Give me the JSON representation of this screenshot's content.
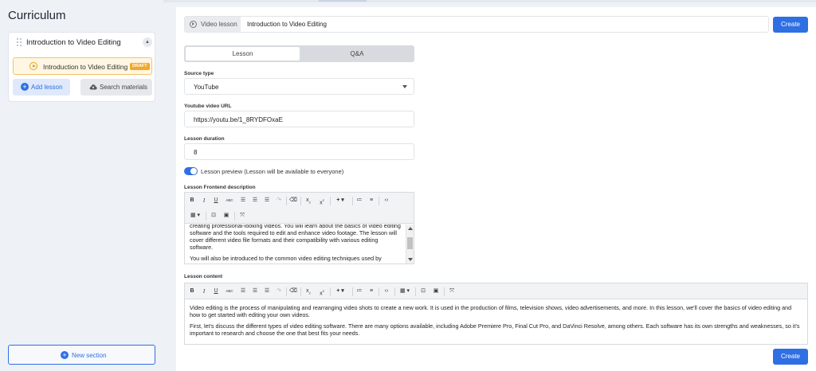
{
  "sidebar": {
    "title": "Curriculum",
    "section": {
      "title": "Introduction to Video Editing",
      "lesson": {
        "label": "Introduction to Video Editing",
        "badge": "DRAFT"
      },
      "add_lesson_label": "Add lesson",
      "search_materials_label": "Search materials"
    },
    "new_section_label": "New section"
  },
  "main": {
    "type_chip_label": "Video lesson",
    "title_value": "Introduction to Video Editing",
    "create_label": "Create",
    "tabs": [
      {
        "label": "Lesson",
        "active": true
      },
      {
        "label": "Q&A",
        "active": false
      }
    ],
    "source_type": {
      "label": "Source type",
      "value": "YouTube"
    },
    "youtube_url": {
      "label": "Youtube video URL",
      "value": "https://youtu.be/1_8RYDFOxaE"
    },
    "duration": {
      "label": "Lesson duration",
      "value": "8"
    },
    "preview": {
      "label": "Lesson preview (Lesson will be available to everyone)",
      "enabled": true
    },
    "frontend_description": {
      "label": "Lesson Frontend description",
      "paragraphs": [
        "creating professional-looking videos. You will learn about the basics of video editing software and the tools required to edit and enhance video footage. The lesson will cover different video file formats and their compatibility with various editing software.",
        "You will also be introduced to the common video editing techniques used by"
      ]
    },
    "content": {
      "label": "Lesson content",
      "paragraphs": [
        "Video editing is the process of manipulating and rearranging video shots to create a new work. It is used in the production of films, television shows, video advertisements, and more. In this lesson, we'll cover the basics of video editing and how to get started with editing your own videos.",
        "First, let's discuss the different types of video editing software. There are many options available, including Adobe Premiere Pro, Final Cut Pro, and DaVinci Resolve, among others. Each software has its own strengths and weaknesses, so it's important to research and choose the one that best fits your needs."
      ]
    }
  },
  "colors": {
    "accent": "#2f6fe4",
    "draft": "#f4a82a",
    "sidebar_bg": "#eef1f6"
  }
}
